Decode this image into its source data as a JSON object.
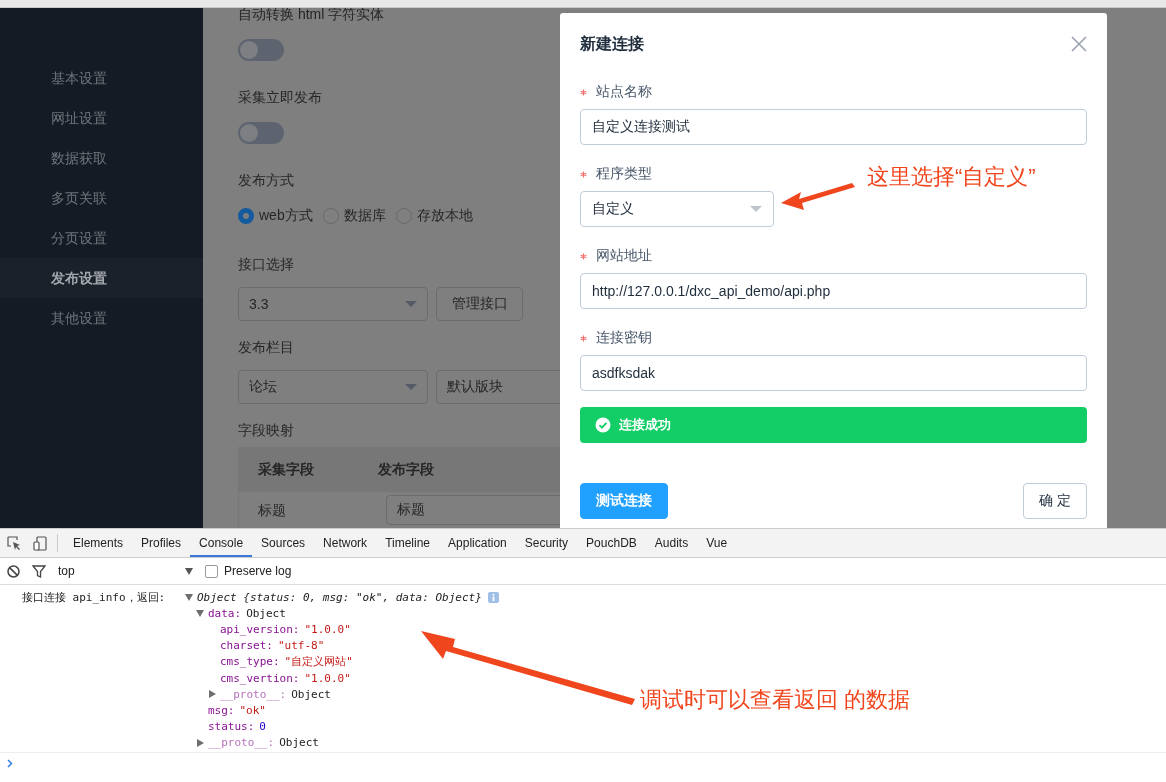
{
  "sidebar": {
    "items": [
      {
        "label": "基本设置",
        "selected": false
      },
      {
        "label": "网址设置",
        "selected": false
      },
      {
        "label": "数据获取",
        "selected": false
      },
      {
        "label": "多页关联",
        "selected": false
      },
      {
        "label": "分页设置",
        "selected": false
      },
      {
        "label": "发布设置",
        "selected": true
      },
      {
        "label": "其他设置",
        "selected": false
      }
    ]
  },
  "settings": {
    "sections": [
      {
        "kind": "switch",
        "label": "自动转换 html 字符实体",
        "on": false
      },
      {
        "kind": "switch",
        "label": "采集立即发布",
        "on": false
      },
      {
        "kind": "radio",
        "label": "发布方式",
        "options": [
          {
            "label": "web方式",
            "selected": true
          },
          {
            "label": "数据库",
            "selected": false
          },
          {
            "label": "存放本地",
            "selected": false
          }
        ]
      },
      {
        "kind": "controls",
        "label": "接口选择",
        "controls": [
          {
            "kind": "select",
            "value": "3.3"
          },
          {
            "kind": "button",
            "label": "管理接口"
          }
        ]
      },
      {
        "kind": "controls",
        "label": "发布栏目",
        "controls": [
          {
            "kind": "select",
            "value": "论坛"
          },
          {
            "kind": "box",
            "value": "默认版块"
          }
        ]
      },
      {
        "kind": "table",
        "label": "字段映射",
        "columns": [
          "采集字段",
          "发布字段"
        ],
        "rows": [
          {
            "field": "标题",
            "target": "标题"
          }
        ]
      }
    ]
  },
  "dialog": {
    "title": "新建连接",
    "fields": [
      {
        "kind": "input",
        "label": "站点名称",
        "required": true,
        "value": "自定义连接测试"
      },
      {
        "kind": "select",
        "label": "程序类型",
        "required": true,
        "value": "自定义"
      },
      {
        "kind": "input",
        "label": "网站地址",
        "required": true,
        "value": "http://127.0.0.1/dxc_api_demo/api.php"
      },
      {
        "kind": "input",
        "label": "连接密钥",
        "required": true,
        "value": "asdfksdak"
      }
    ],
    "alert": {
      "kind": "success",
      "text": "连接成功"
    },
    "buttons": [
      {
        "label": "测试连接",
        "primary": true
      },
      {
        "label": "确 定",
        "primary": false
      }
    ]
  },
  "annotations": [
    {
      "text": "这里选择“自定义”"
    },
    {
      "text": "调试时可以查看返回 的数据"
    }
  ],
  "devtools": {
    "tabs": [
      {
        "label": "Elements",
        "selected": false
      },
      {
        "label": "Profiles",
        "selected": false
      },
      {
        "label": "Console",
        "selected": true
      },
      {
        "label": "Sources",
        "selected": false
      },
      {
        "label": "Network",
        "selected": false
      },
      {
        "label": "Timeline",
        "selected": false
      },
      {
        "label": "Application",
        "selected": false
      },
      {
        "label": "Security",
        "selected": false
      },
      {
        "label": "PouchDB",
        "selected": false
      },
      {
        "label": "Audits",
        "selected": false
      },
      {
        "label": "Vue",
        "selected": false
      }
    ],
    "toolbar": {
      "context": "top",
      "preserve_log": {
        "label": "Preserve log",
        "checked": false
      }
    },
    "console": {
      "prefix": "接口连接 api_info，返回:",
      "summary": "Object {status: 0, msg: \"ok\", data: Object}",
      "expanded": true,
      "children": [
        {
          "key": "data:",
          "value": "Object",
          "kind": "object",
          "expanded": true,
          "children": [
            {
              "key": "api_version:",
              "value": "\"1.0.0\"",
              "kind": "string"
            },
            {
              "key": "charset:",
              "value": "\"utf-8\"",
              "kind": "string"
            },
            {
              "key": "cms_type:",
              "value": "\"自定义网站\"",
              "kind": "string"
            },
            {
              "key": "cms_vertion:",
              "value": "\"1.0.0\"",
              "kind": "string"
            },
            {
              "key": "__proto__:",
              "value": "Object",
              "kind": "proto",
              "expanded": false
            }
          ]
        },
        {
          "key": "msg:",
          "value": "\"ok\"",
          "kind": "string"
        },
        {
          "key": "status:",
          "value": "0",
          "kind": "number"
        },
        {
          "key": "__proto__:",
          "value": "Object",
          "kind": "proto",
          "expanded": false
        }
      ]
    }
  }
}
